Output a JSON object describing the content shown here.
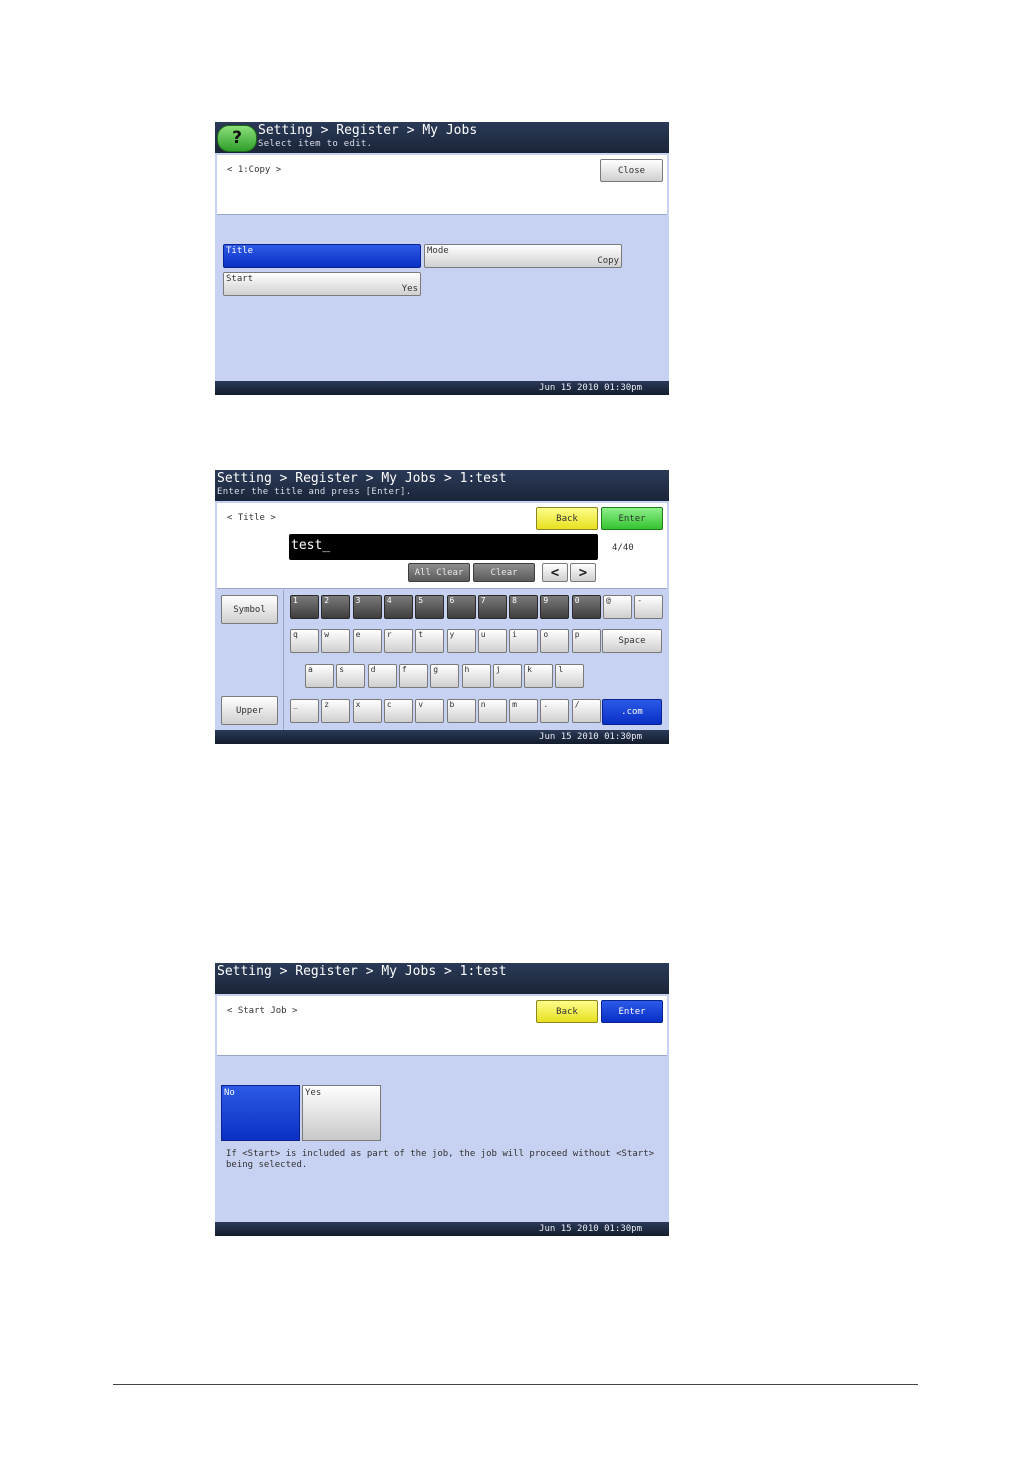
{
  "screen1": {
    "breadcrumb": "Setting > Register > My Jobs",
    "subtitle": "Select item to edit.",
    "help_label": "?",
    "panel_label": "< 1:Copy >",
    "close_label": "Close",
    "items": [
      {
        "label": "Title",
        "value": ""
      },
      {
        "label": "Mode",
        "value": "Copy"
      },
      {
        "label": "Start",
        "value": "Yes"
      }
    ],
    "datetime": "Jun 15 2010 01:30pm"
  },
  "screen2": {
    "breadcrumb": "Setting > Register > My Jobs > 1:test",
    "subtitle": "Enter the title and press [Enter].",
    "panel_label": "< Title >",
    "back_label": "Back",
    "enter_label": "Enter",
    "input_value": "test_",
    "counter": "4/40",
    "all_clear_label": "All Clear",
    "clear_label": "Clear",
    "left_arrow": "<",
    "right_arrow": ">",
    "symbol_label": "Symbol",
    "upper_label": "Upper",
    "space_label": "Space",
    "com_label": ".com",
    "row1": [
      "1",
      "2",
      "3",
      "4",
      "5",
      "6",
      "7",
      "8",
      "9",
      "0",
      "@",
      "-"
    ],
    "row2": [
      "q",
      "w",
      "e",
      "r",
      "t",
      "y",
      "u",
      "i",
      "o",
      "p"
    ],
    "row3": [
      "a",
      "s",
      "d",
      "f",
      "g",
      "h",
      "j",
      "k",
      "l"
    ],
    "row4": [
      "_",
      "z",
      "x",
      "c",
      "v",
      "b",
      "n",
      "m",
      ".",
      "/"
    ],
    "datetime": "Jun 15 2010 01:30pm"
  },
  "screen3": {
    "breadcrumb": "Setting > Register > My Jobs > 1:test",
    "panel_label": "< Start Job >",
    "back_label": "Back",
    "enter_label": "Enter",
    "no_label": "No",
    "yes_label": "Yes",
    "note": "If <Start> is included as part of the job, the job will proceed without <Start> being selected.",
    "datetime": "Jun 15 2010 01:30pm"
  }
}
